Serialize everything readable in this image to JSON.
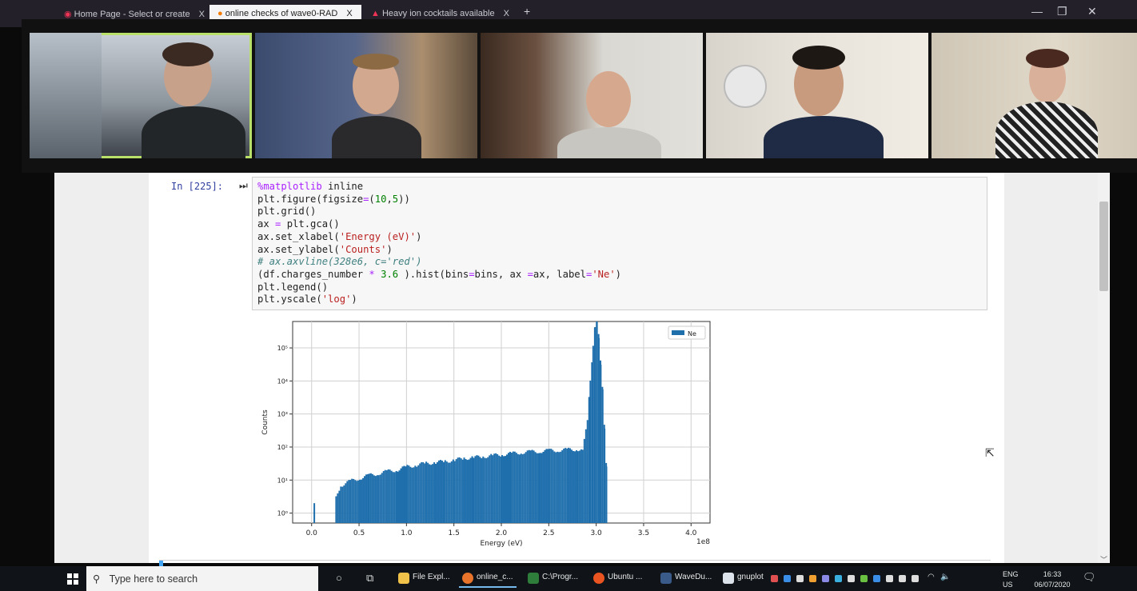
{
  "browser": {
    "tabs": [
      {
        "label": "Home Page - Select or create",
        "close": "X"
      },
      {
        "label": "online checks of wave0-RAD",
        "close": "X"
      },
      {
        "label": "Heavy ion cocktails available",
        "close": "X"
      }
    ],
    "new_tab": "+",
    "window_controls": [
      "—",
      "❐",
      "✕"
    ]
  },
  "notebook": {
    "cell_prompt": "In [225]:",
    "code_lines": [
      {
        "tokens": [
          {
            "t": "%matplotlib",
            "c": "magic"
          },
          {
            "t": " inline",
            "c": ""
          }
        ]
      },
      {
        "tokens": [
          {
            "t": "plt.figure(figsize",
            "c": ""
          },
          {
            "t": "=",
            "c": "op"
          },
          {
            "t": "(",
            "c": ""
          },
          {
            "t": "10",
            "c": "num"
          },
          {
            "t": ",",
            "c": ""
          },
          {
            "t": "5",
            "c": "num"
          },
          {
            "t": "))",
            "c": ""
          }
        ]
      },
      {
        "tokens": [
          {
            "t": "plt.grid()",
            "c": ""
          }
        ]
      },
      {
        "tokens": [
          {
            "t": "ax ",
            "c": ""
          },
          {
            "t": "=",
            "c": "op"
          },
          {
            "t": " plt.gca()",
            "c": ""
          }
        ]
      },
      {
        "tokens": [
          {
            "t": "ax.set_xlabel(",
            "c": ""
          },
          {
            "t": "'Energy (eV)'",
            "c": "str"
          },
          {
            "t": ")",
            "c": ""
          }
        ]
      },
      {
        "tokens": [
          {
            "t": "ax.set_ylabel(",
            "c": ""
          },
          {
            "t": "'Counts'",
            "c": "str"
          },
          {
            "t": ")",
            "c": ""
          }
        ]
      },
      {
        "tokens": [
          {
            "t": "# ax.axvline(328e6, c='red')",
            "c": "cmt"
          }
        ]
      },
      {
        "tokens": [
          {
            "t": "(df.charges_number ",
            "c": ""
          },
          {
            "t": "*",
            "c": "op"
          },
          {
            "t": " ",
            "c": ""
          },
          {
            "t": "3.6",
            "c": "num"
          },
          {
            "t": " ).hist(bins",
            "c": ""
          },
          {
            "t": "=",
            "c": "op"
          },
          {
            "t": "bins, ax ",
            "c": ""
          },
          {
            "t": "=",
            "c": "op"
          },
          {
            "t": "ax, label",
            "c": ""
          },
          {
            "t": "=",
            "c": "op"
          },
          {
            "t": "'Ne'",
            "c": "str"
          },
          {
            "t": ")",
            "c": ""
          }
        ]
      },
      {
        "tokens": [
          {
            "t": "plt.legend()",
            "c": ""
          }
        ]
      },
      {
        "tokens": [
          {
            "t": "plt.yscale(",
            "c": ""
          },
          {
            "t": "'log'",
            "c": "str"
          },
          {
            "t": ")",
            "c": ""
          }
        ]
      }
    ]
  },
  "chart_data": {
    "type": "bar",
    "xlabel": "Energy (eV)",
    "ylabel": "Counts",
    "x_offset_label": "1e8",
    "xlim": [
      -0.2,
      4.2
    ],
    "ylim_log10": [
      -0.3,
      5.8
    ],
    "log_y": true,
    "grid": true,
    "legend": "top-right",
    "xticks": [
      "0.0",
      "0.5",
      "1.0",
      "1.5",
      "2.0",
      "2.5",
      "3.0",
      "3.5",
      "4.0"
    ],
    "yticks": [
      "10⁰",
      "10¹",
      "10²",
      "10³",
      "10⁴",
      "10⁵"
    ],
    "color": "#1f6fad",
    "series": [
      {
        "name": "Ne",
        "x": [
          0.02,
          0.25,
          0.3,
          0.4,
          0.5,
          0.6,
          0.7,
          0.8,
          0.9,
          1.0,
          1.1,
          1.2,
          1.3,
          1.4,
          1.5,
          1.6,
          1.7,
          1.8,
          1.9,
          2.0,
          2.1,
          2.2,
          2.3,
          2.4,
          2.5,
          2.6,
          2.7,
          2.8,
          2.85,
          2.9,
          2.93,
          2.96,
          2.98,
          3.0,
          3.02,
          3.04,
          3.06,
          3.08,
          3.1
        ],
        "values": [
          2,
          2.5,
          6,
          8,
          10,
          12,
          14,
          16,
          18,
          22,
          25,
          28,
          30,
          32,
          35,
          40,
          42,
          45,
          48,
          52,
          55,
          60,
          62,
          65,
          68,
          70,
          72,
          75,
          70,
          500,
          10000,
          100000,
          400000,
          600000,
          200000,
          30000,
          5000,
          300,
          20
        ]
      }
    ]
  },
  "taskbar": {
    "search_placeholder": "Type here to search",
    "apps": [
      "File Expl...",
      "online_c...",
      "C:\\Progr...",
      "Ubuntu ...",
      "WaveDu...",
      "gnuplot"
    ],
    "lang_top": "ENG",
    "lang_bottom": "US",
    "time": "16:33",
    "date": "06/07/2020"
  }
}
